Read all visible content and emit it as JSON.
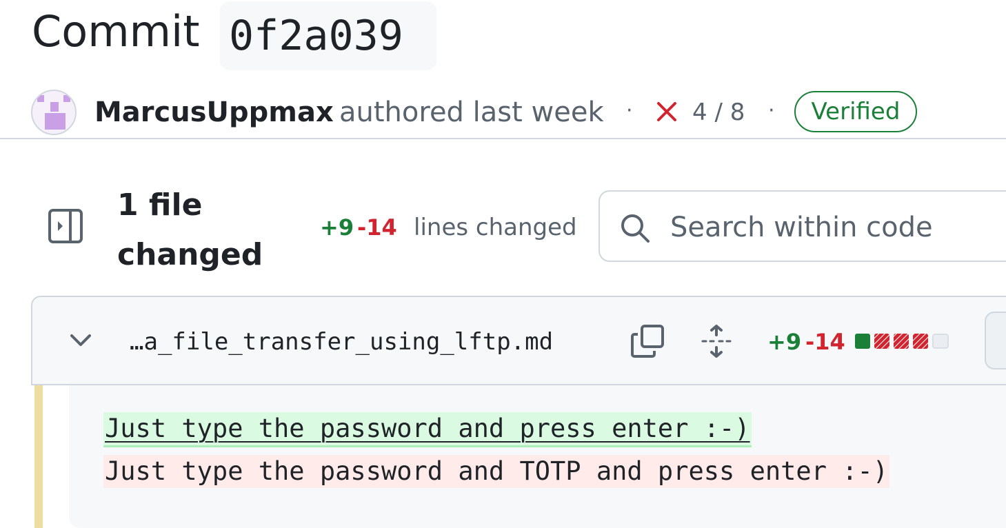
{
  "commit": {
    "title_word": "Commit",
    "sha": "0f2a039"
  },
  "author_row": {
    "author": "MarcusUppmax",
    "authored_text": "authored last week",
    "separator": "·",
    "checks_status": "failing",
    "checks_text": "4 / 8",
    "verified_label": "Verified"
  },
  "summary": {
    "files_changed": "1 file changed",
    "additions": "+9",
    "deletions": "-14",
    "lines_changed_label": "lines changed",
    "search_placeholder": "Search within code"
  },
  "file": {
    "name": "…a_file_transfer_using_lftp.md",
    "additions": "+9",
    "deletions": "-14",
    "diffstat_blocks": [
      "added",
      "removed",
      "removed",
      "removed",
      "neutral"
    ]
  },
  "diff": {
    "added_line": "Just type the password and press enter :-)",
    "removed_line": "Just type the password and TOTP and press enter :-)"
  },
  "colors": {
    "added": "#1a7f37",
    "removed": "#d1242f",
    "added_bg": "#dafbe1",
    "removed_bg": "#ffebe9",
    "muted": "#59636e"
  },
  "icons": {
    "checks": "x-icon",
    "sidebar": "sidebar-expand-icon",
    "search": "search-icon",
    "collapse": "chevron-down-icon",
    "copy": "copy-icon",
    "expand": "unfold-icon"
  }
}
